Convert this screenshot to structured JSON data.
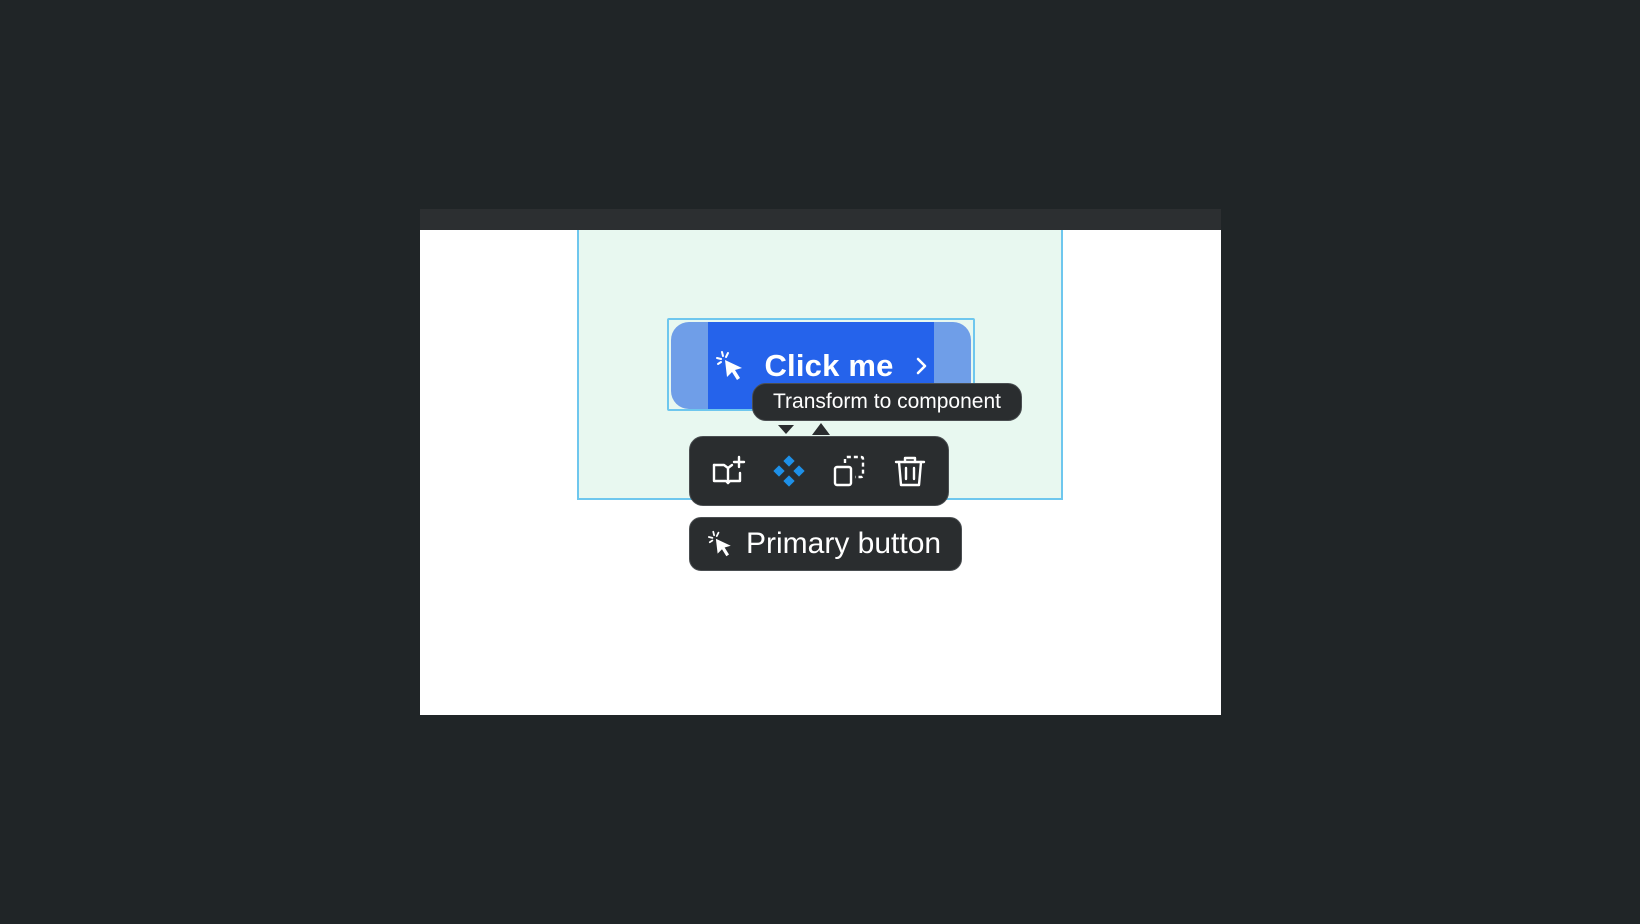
{
  "canvas": {
    "button": {
      "label": "Click me",
      "leading_icon": "cursor-click-icon",
      "trailing_icon": "chevron-right-icon",
      "color": "#2563eb"
    }
  },
  "tooltip": {
    "text": "Transform to component"
  },
  "toolbar": {
    "items": [
      {
        "name": "add-to-library",
        "icon": "book-plus-icon"
      },
      {
        "name": "transform-to-component",
        "icon": "component-diamond-icon",
        "active": true,
        "color": "#1e90e8"
      },
      {
        "name": "duplicate",
        "icon": "duplicate-icon"
      },
      {
        "name": "delete",
        "icon": "trash-icon"
      }
    ]
  },
  "selection_label": {
    "icon": "cursor-click-icon",
    "text": "Primary button"
  }
}
